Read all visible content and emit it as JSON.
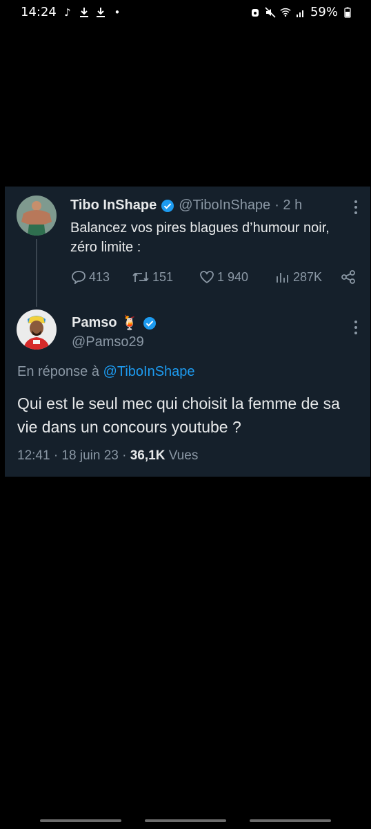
{
  "status_bar": {
    "time": "14:24",
    "left_icons": [
      "tiktok-icon",
      "download-icon",
      "download-icon",
      "dot-icon"
    ],
    "right_icons": [
      "alarm-icon",
      "mute-icon",
      "wifi-icon",
      "signal-icon"
    ],
    "battery": "59%"
  },
  "tweet_parent": {
    "name": "Tibo InShape",
    "handle": "@TiboInShape",
    "time": "· 2 h",
    "text": "Balancez vos pires blagues d’humour noir, zéro limite :",
    "replies": "413",
    "retweets": "151",
    "likes": "1 940",
    "views": "287K"
  },
  "tweet_reply": {
    "name": "Pamso",
    "emoji": "🍹",
    "handle": "@Pamso29",
    "reply_prefix": "En réponse à",
    "reply_to": "@TiboInShape",
    "text": "Qui est le seul mec qui choisit la femme de sa vie dans un concours youtube ?",
    "time": "12:41 · 18 juin 23 ·",
    "views_count": "36,1K",
    "views_label": "Vues"
  },
  "colors": {
    "background": "#000000",
    "card": "#15202b",
    "text": "#e7e9ea",
    "muted": "#8b98a5",
    "link": "#1d9bf0",
    "verified": "#1d9bf0"
  }
}
